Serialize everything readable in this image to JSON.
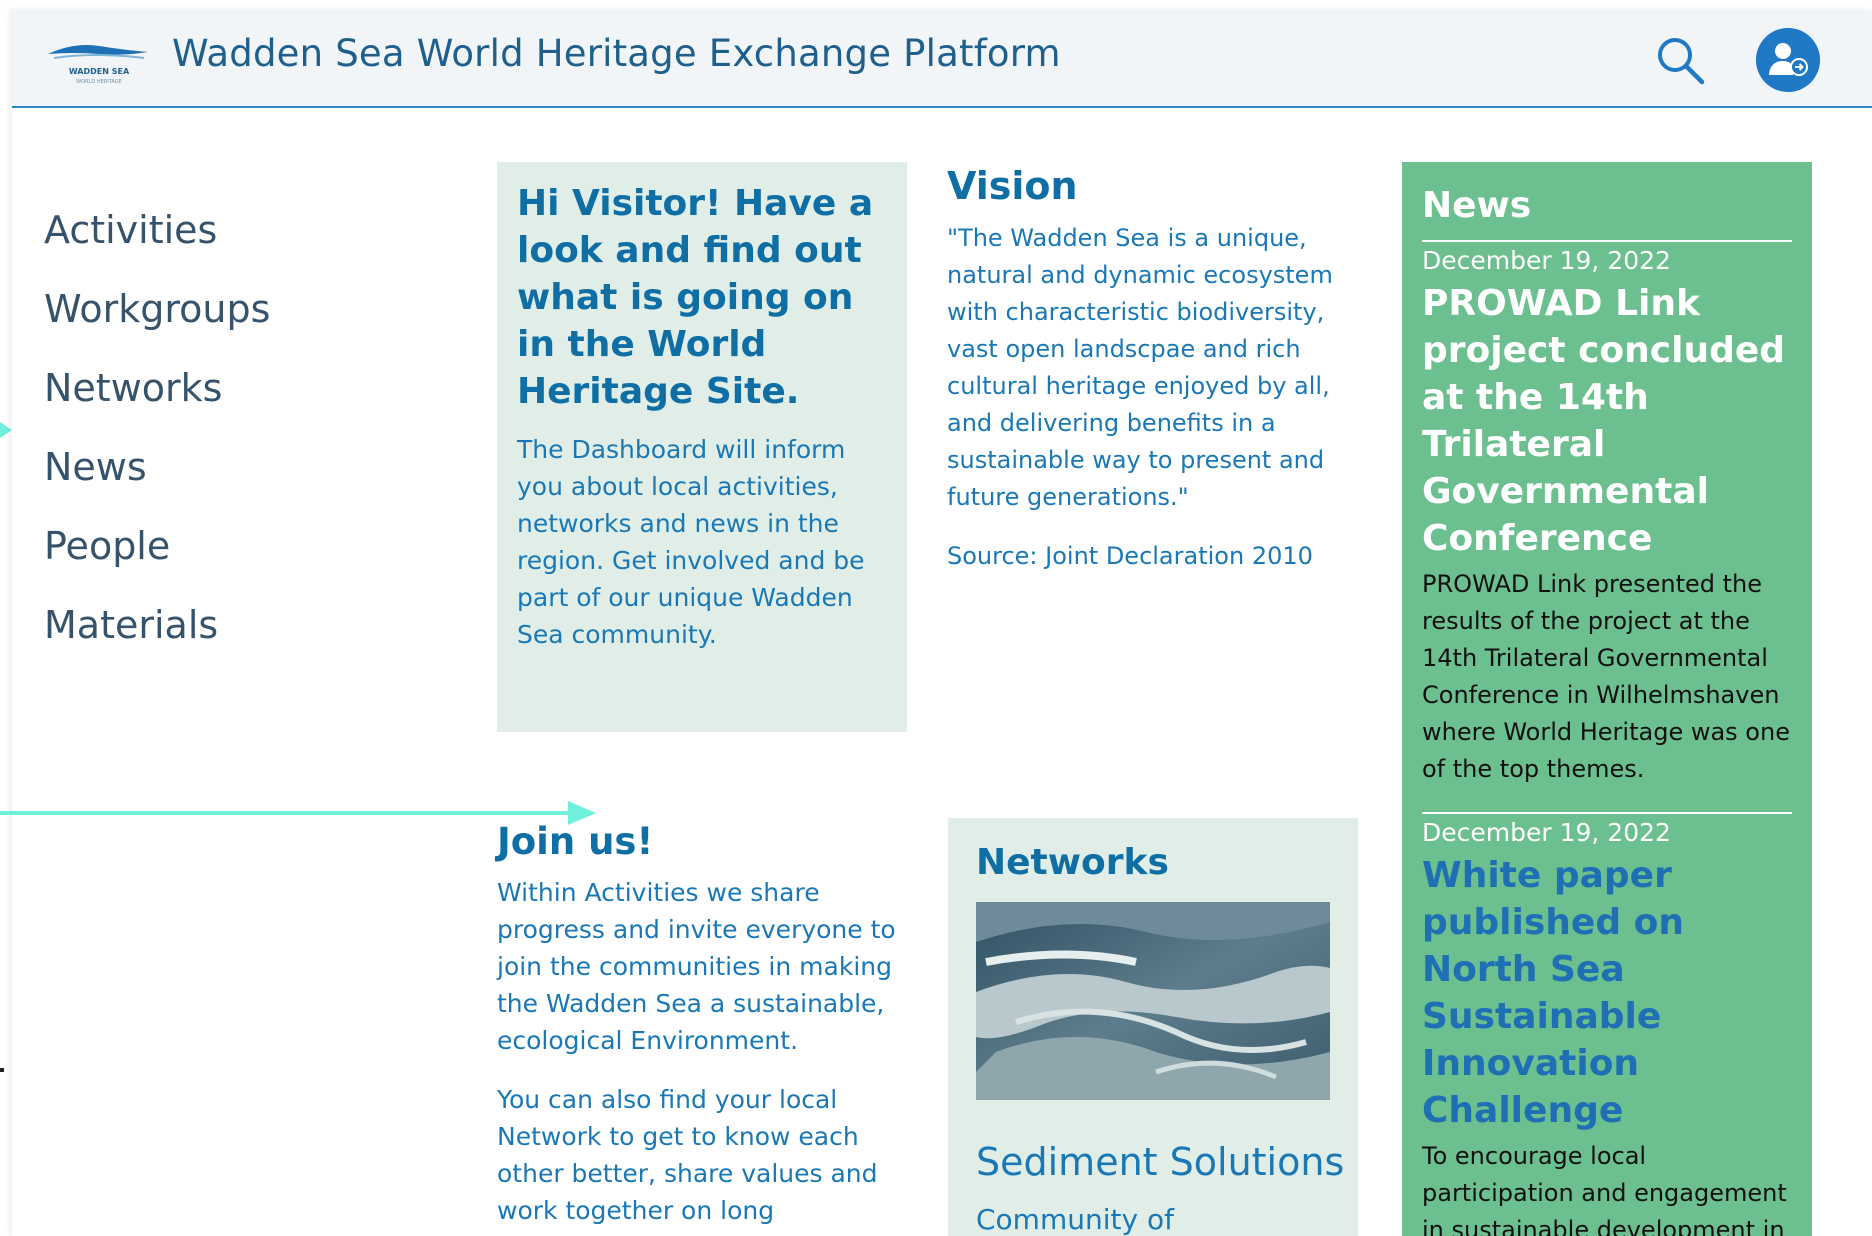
{
  "header": {
    "title": "Wadden Sea World Heritage Exchange Platform",
    "logo_text": "WADDEN SEA",
    "logo_subtext": "WORLD HERITAGE"
  },
  "sidebar": {
    "items": [
      {
        "label": "Activities"
      },
      {
        "label": "Workgroups"
      },
      {
        "label": "Networks"
      },
      {
        "label": "News"
      },
      {
        "label": "People"
      },
      {
        "label": "Materials"
      }
    ]
  },
  "welcome": {
    "title": "Hi Visitor! Have a look and find out what is going on in the World Heritage Site.",
    "body": "The Dashboard will inform you about local activities, networks and news in the region. Get involved and be part of our unique Wadden Sea community."
  },
  "vision": {
    "title": "Vision",
    "quote": "\"The Wadden Sea is a unique, natural and dynamic ecosystem with characteristic biodiversity, vast open landscpae and rich cultural heritage enjoyed by all, and delivering benefits in a sustainable way to present and future generations.\"",
    "source": "Source: Joint Declaration 2010"
  },
  "join": {
    "title": "Join us!",
    "paragraph1": "Within Activities we share progress and invite everyone to join the communities in making the Wadden Sea a sustainable, ecological Environment.",
    "paragraph2": "You can also find your local Network to get to know each other better, share values and work together on long"
  },
  "networks": {
    "title": "Networks",
    "item_title": "Sediment Solutions",
    "item_subtitle": "Community of"
  },
  "news": {
    "title": "News",
    "items": [
      {
        "date": "December 19, 2022",
        "title": "PROWAD Link project concluded at the 14th Trilateral Governmental Conference",
        "body": "PROWAD Link presented the results of the project at the 14th Trilateral Governmental Conference in Wilhelmshaven where World Heritage was one of the top themes."
      },
      {
        "date": "December 19, 2022",
        "title": "White paper published on North Sea Sustainable Innovation Challenge",
        "body": "To encourage local participation and engagement in sustainable development in"
      }
    ]
  },
  "colors": {
    "brand_blue": "#0f6fa5",
    "text_blue": "#1978b5",
    "news_green": "#6cc08f",
    "card_mint": "#e0eee7",
    "header_line": "#2b86c5",
    "annotation_cyan": "#6ef0dc"
  },
  "icons": {
    "search": "search-icon",
    "user": "user-login-icon",
    "logo": "wadden-sea-logo"
  }
}
